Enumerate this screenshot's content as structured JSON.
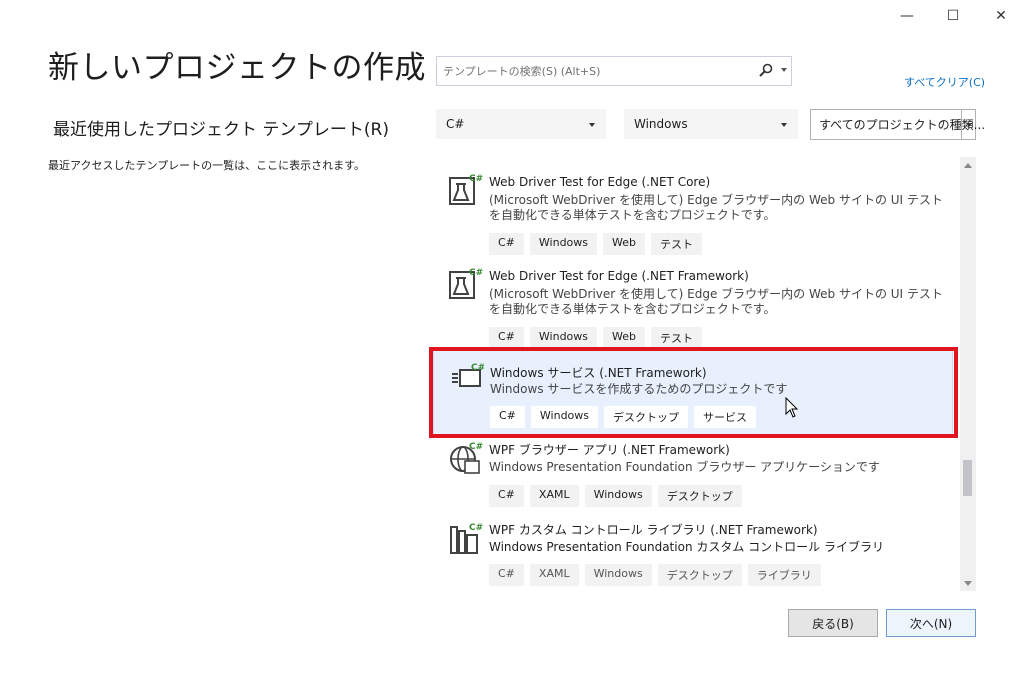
{
  "window": {
    "minimize_glyph": "—",
    "maximize_glyph": "☐",
    "close_glyph": "✕"
  },
  "header": {
    "title": "新しいプロジェクトの作成",
    "recent_title": "最近使用したプロジェクト テンプレート(R)",
    "recent_desc": "最近アクセスしたテンプレートの一覧は、ここに表示されます。"
  },
  "search": {
    "placeholder": "テンプレートの検索(S) (Alt+S)",
    "clear_all": "すべてクリア(C)"
  },
  "filters": {
    "language": "C#",
    "platform": "Windows",
    "project_type": "すべてのプロジェクトの種類..."
  },
  "templates": [
    {
      "name": "Web Driver Test for Edge (.NET Core)",
      "desc": "(Microsoft WebDriver を使用して) Edge ブラウザー内の Web サイトの UI テストを自動化できる単体テストを含むプロジェクトです。",
      "tags": [
        "C#",
        "Windows",
        "Web",
        "テスト"
      ]
    },
    {
      "name": "Web Driver Test for Edge (.NET Framework)",
      "desc": "(Microsoft WebDriver を使用して) Edge ブラウザー内の Web サイトの UI テストを自動化できる単体テストを含むプロジェクトです。",
      "tags": [
        "C#",
        "Windows",
        "Web",
        "テスト"
      ]
    },
    {
      "name": "Windows サービス (.NET Framework)",
      "desc": "Windows サービスを作成するためのプロジェクトです",
      "tags": [
        "C#",
        "Windows",
        "デスクトップ",
        "サービス"
      ]
    },
    {
      "name": "WPF ブラウザー アプリ (.NET Framework)",
      "desc": "Windows Presentation Foundation ブラウザー アプリケーションです",
      "tags": [
        "C#",
        "XAML",
        "Windows",
        "デスクトップ"
      ]
    },
    {
      "name": "WPF カスタム コントロール ライブラリ (.NET Framework)",
      "desc": "Windows Presentation Foundation カスタム コントロール ライブラリ",
      "tags": [
        "C#",
        "XAML",
        "Windows",
        "デスクトップ",
        "ライブラリ"
      ]
    }
  ],
  "icon_badge": "C#",
  "buttons": {
    "back": "戻る(B)",
    "next": "次へ(N)"
  },
  "colors": {
    "highlight": "#e0151f",
    "selected_bg": "#e8f0fe",
    "link": "#0e70c0"
  }
}
